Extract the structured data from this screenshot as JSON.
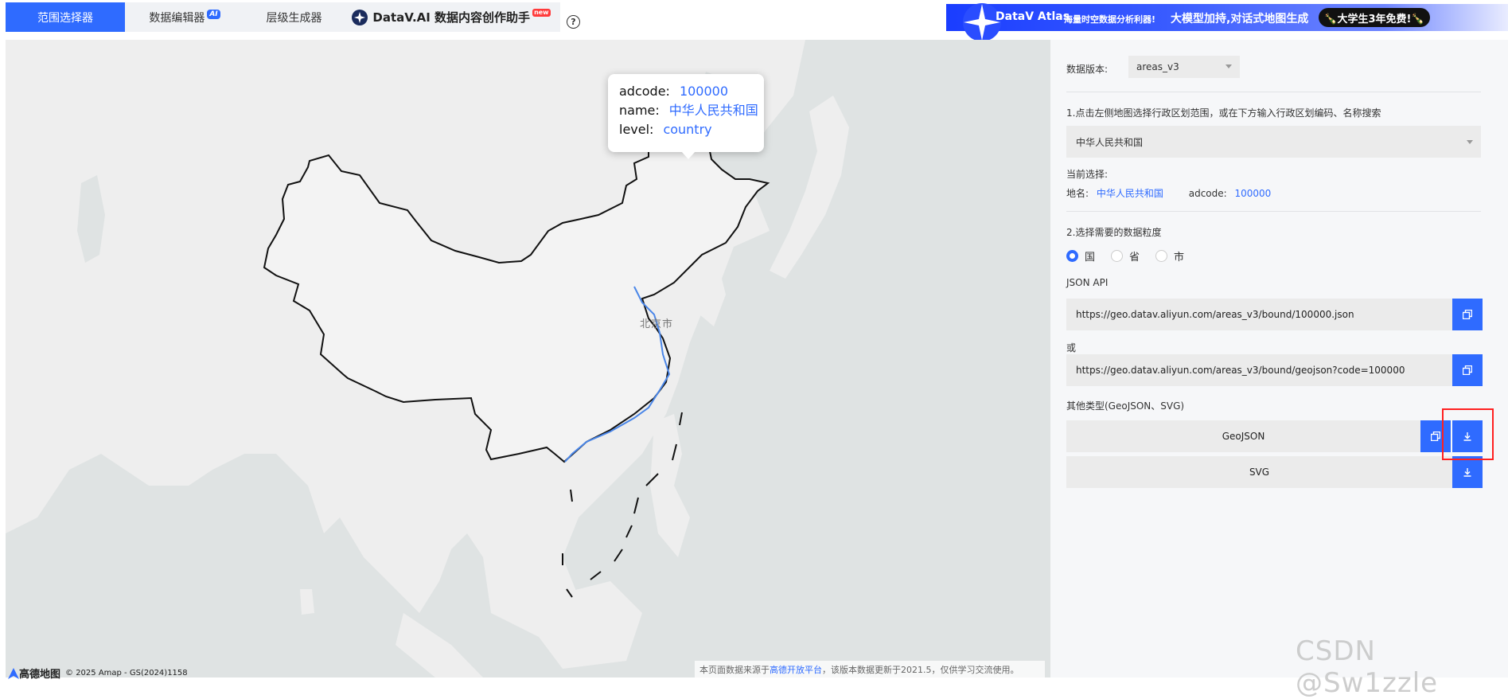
{
  "nav": {
    "tabs": [
      {
        "label": "范围选择器",
        "active": true
      },
      {
        "label": "数据编辑器",
        "badge": "AI"
      },
      {
        "label": "层级生成器"
      },
      {
        "label": "DataV.AI 数据内容创作助手",
        "badge": "new"
      }
    ],
    "help": "?"
  },
  "banner": {
    "title": "DataV Atlas",
    "subtitle": "海量时空数据分析利器!",
    "main": "大模型加持,对话式地图生成",
    "cta": "🍾大学生3年免费!🍾"
  },
  "map": {
    "tooltip": {
      "adcode_key": "adcode:",
      "adcode_val": "100000",
      "name_key": "name:",
      "name_val": "中华人民共和国",
      "level_key": "level:",
      "level_val": "country"
    },
    "city_label": "北京市",
    "amap_brand": "高德地图",
    "copyright": "© 2025 Amap - GS(2024)1158",
    "note_prefix": "本页面数据来源于",
    "note_link": "高德开放平台",
    "note_suffix": "，该版本数据更新于2021.5，仅供学习交流使用。"
  },
  "panel": {
    "version_label": "数据版本:",
    "version_value": "areas_v3",
    "step1": "1.点击左侧地图选择行政区划范围，或在下方输入行政区划编码、名称搜索",
    "search_value": "中华人民共和国",
    "current_label": "当前选择:",
    "name_label": "地名:",
    "name_value": "中华人民共和国",
    "adcode_label": "adcode:",
    "adcode_value": "100000",
    "step2": "2.选择需要的数据粒度",
    "granularity": [
      "国",
      "省",
      "市"
    ],
    "json_api_label": "JSON API",
    "url1": "https://geo.datav.aliyun.com/areas_v3/bound/100000.json",
    "or_label": "或",
    "url2": "https://geo.datav.aliyun.com/areas_v3/bound/geojson?code=100000",
    "other_label": "其他类型(GeoJSON、SVG)",
    "geojson_btn": "GeoJSON",
    "svg_btn": "SVG"
  },
  "watermark": "CSDN @Sw1zzle",
  "colors": {
    "accent": "#2f6bff",
    "highlight": "#ff2020"
  }
}
